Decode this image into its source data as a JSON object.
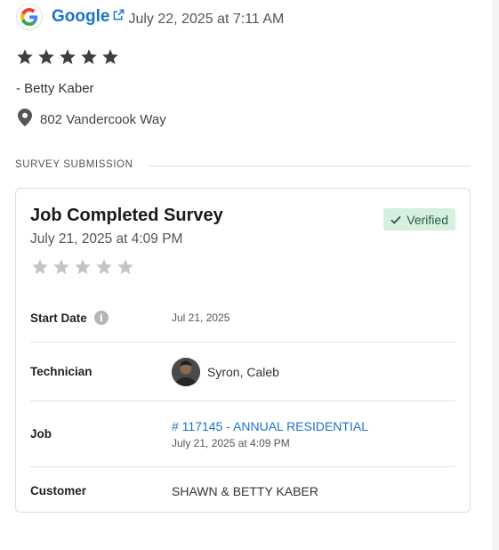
{
  "review": {
    "source": "Google",
    "date": "July 22, 2025 at 7:11 AM",
    "rating": 5,
    "reviewer": "- Betty Kaber",
    "location": "802 Vandercook Way"
  },
  "section": {
    "label": "SURVEY SUBMISSION"
  },
  "survey": {
    "title": "Job Completed Survey",
    "date": "July 21, 2025 at 4:09 PM",
    "verified_label": "Verified",
    "rating": 0,
    "rows": {
      "start_date_label": "Start Date",
      "start_date_value": "Jul 21, 2025",
      "technician_label": "Technician",
      "technician_value": "Syron, Caleb",
      "job_label": "Job",
      "job_link": "# 117145 - ANNUAL RESIDENTIAL",
      "job_date": "July 21, 2025 at 4:09 PM",
      "customer_label": "Customer",
      "customer_value": "SHAWN & BETTY KABER"
    }
  },
  "colors": {
    "link": "#1a73c8",
    "star_filled": "#3f3f3f",
    "star_empty": "#c4c4c4",
    "verified_bg": "#d5f0e0"
  },
  "icons": {
    "source": "google-logo-icon",
    "external": "external-link-icon",
    "location": "map-pin-icon",
    "verified": "check-icon",
    "info": "info-icon"
  }
}
